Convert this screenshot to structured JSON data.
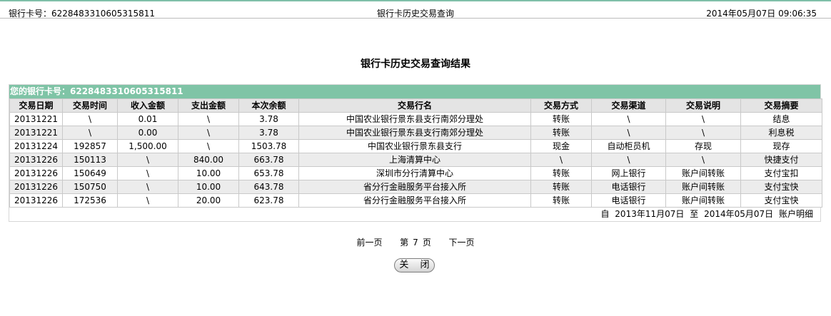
{
  "header": {
    "card_label": "银行卡号：6228483310605315811",
    "title": "银行卡历史交易查询",
    "datetime": "2014年05月07日 09:06:35"
  },
  "page_title": "银行卡历史交易查询结果",
  "card_banner": "您的银行卡号：6228483310605315811",
  "table": {
    "columns": [
      "交易日期",
      "交易时间",
      "收入金额",
      "支出金额",
      "本次余额",
      "交易行名",
      "交易方式",
      "交易渠道",
      "交易说明",
      "交易摘要"
    ],
    "rows": [
      [
        "20131221",
        "\\",
        "0.01",
        "\\",
        "3.78",
        "中国农业银行景东县支行南郊分理处",
        "转账",
        "\\",
        "\\",
        "结息"
      ],
      [
        "20131221",
        "\\",
        "0.00",
        "\\",
        "3.78",
        "中国农业银行景东县支行南郊分理处",
        "转账",
        "\\",
        "\\",
        "利息税"
      ],
      [
        "20131224",
        "192857",
        "1,500.00",
        "\\",
        "1503.78",
        "中国农业银行景东县支行",
        "现金",
        "自动柜员机",
        "存现",
        "现存"
      ],
      [
        "20131226",
        "150113",
        "\\",
        "840.00",
        "663.78",
        "上海清算中心",
        "\\",
        "\\",
        "\\",
        "快捷支付"
      ],
      [
        "20131226",
        "150649",
        "\\",
        "10.00",
        "653.78",
        "深圳市分行清算中心",
        "转账",
        "网上银行",
        "账户间转账",
        "支付宝扣"
      ],
      [
        "20131226",
        "150750",
        "\\",
        "10.00",
        "643.78",
        "省分行金融服务平台接入所",
        "转账",
        "电话银行",
        "账户间转账",
        "支付宝快"
      ],
      [
        "20131226",
        "172536",
        "\\",
        "20.00",
        "623.78",
        "省分行金融服务平台接入所",
        "转账",
        "电话银行",
        "账户间转账",
        "支付宝快"
      ]
    ]
  },
  "range": {
    "from_label": "自",
    "from_date": "2013年11月07日",
    "to_label": "至",
    "to_date": "2014年05月07日",
    "suffix": "账户明细"
  },
  "pager": {
    "prev": "前一页",
    "page_prefix": "第",
    "page_number": "7",
    "page_suffix": "页",
    "next": "下一页"
  },
  "close_button": "关 闭"
}
